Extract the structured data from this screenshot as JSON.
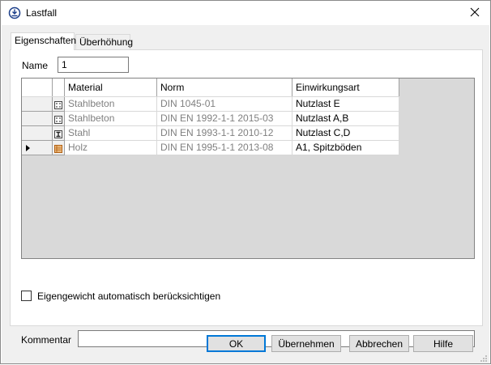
{
  "window": {
    "title": "Lastfall",
    "icon": "lastfall-app-icon",
    "close_glyph": "✕"
  },
  "tabs": [
    {
      "label": "Eigenschaften",
      "active": true
    },
    {
      "label": "Überhöhung",
      "active": false
    }
  ],
  "form": {
    "name_label": "Name",
    "name_value": "1",
    "checkbox_label": "Eigengewicht automatisch berücksichtigen",
    "checkbox_checked": false,
    "kommentar_label": "Kommentar",
    "kommentar_value": ""
  },
  "grid": {
    "columns": [
      "Material",
      "Norm",
      "Einwirkungsart"
    ],
    "rows": [
      {
        "material": "Stahlbeton",
        "norm": "DIN 1045-01",
        "art": "Nutzlast E",
        "icon": "concrete-icon",
        "current": false
      },
      {
        "material": "Stahlbeton",
        "norm": "DIN EN 1992-1-1 2015-03",
        "art": "Nutzlast A,B",
        "icon": "concrete-icon",
        "current": false
      },
      {
        "material": "Stahl",
        "norm": "DIN EN 1993-1-1 2010-12",
        "art": "Nutzlast C,D",
        "icon": "steel-i-beam-icon",
        "current": false
      },
      {
        "material": "Holz",
        "norm": "DIN EN 1995-1-1 2013-08",
        "art": "A1, Spitzböden",
        "icon": "timber-icon",
        "current": true
      }
    ]
  },
  "buttons": {
    "ok": "OK",
    "apply": "Übernehmen",
    "cancel": "Abbrechen",
    "help": "Hilfe"
  },
  "colors": {
    "accent": "#0078d7",
    "grid_background": "#d9d9d9",
    "disabled_text": "#808080",
    "timber_icon": "#d9822b"
  }
}
